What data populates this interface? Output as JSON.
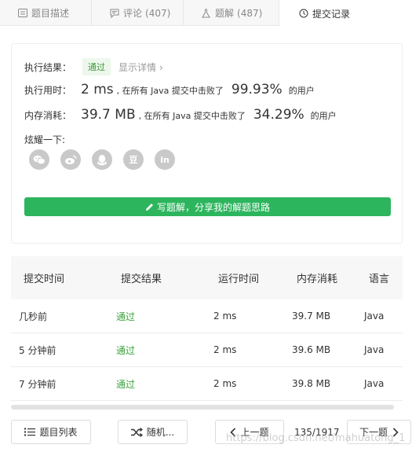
{
  "tabs": {
    "description": "题目描述",
    "comments": "评论",
    "comments_count": "(407)",
    "solutions": "题解",
    "solutions_count": "(487)",
    "submissions": "提交记录"
  },
  "result": {
    "result_label": "执行结果：",
    "status": "通过",
    "details_link": "显示详情 ›",
    "time_label": "执行用时：",
    "time_value": "2 ms",
    "time_text": ", 在所有 Java 提交中击败了",
    "time_pct": "99.93%",
    "time_suffix": "的用户",
    "mem_label": "内存消耗：",
    "mem_value": "39.7 MB",
    "mem_text": ", 在所有 Java 提交中击败了",
    "mem_pct": "34.29%",
    "mem_suffix": "的用户",
    "share_label": "炫耀一下:",
    "social": [
      {
        "icon": "wechat-icon"
      },
      {
        "icon": "weibo-icon"
      },
      {
        "icon": "qq-icon"
      },
      {
        "icon": "douban-icon",
        "text": "豆"
      },
      {
        "icon": "linkedin-icon",
        "text": "in"
      }
    ],
    "write_solution": "写题解，分享我的解题思路"
  },
  "table": {
    "headers": [
      "提交时间",
      "提交结果",
      "运行时间",
      "内存消耗",
      "语言"
    ],
    "rows": [
      [
        "几秒前",
        "通过",
        "2 ms",
        "39.7 MB",
        "Java"
      ],
      [
        "5 分钟前",
        "通过",
        "2 ms",
        "39.6 MB",
        "Java"
      ],
      [
        "7 分钟前",
        "通过",
        "2 ms",
        "39.8 MB",
        "Java"
      ]
    ]
  },
  "footer": {
    "list_label": "题目列表",
    "random_label": "随机...",
    "prev_label": "上一题",
    "page_indicator": "135/1917",
    "next_label": "下一题"
  },
  "watermark": "https://blog.csdn.net/mahuatong_1",
  "colors": {
    "accent_green": "#2db55d",
    "pass_green": "#3ca23c"
  }
}
